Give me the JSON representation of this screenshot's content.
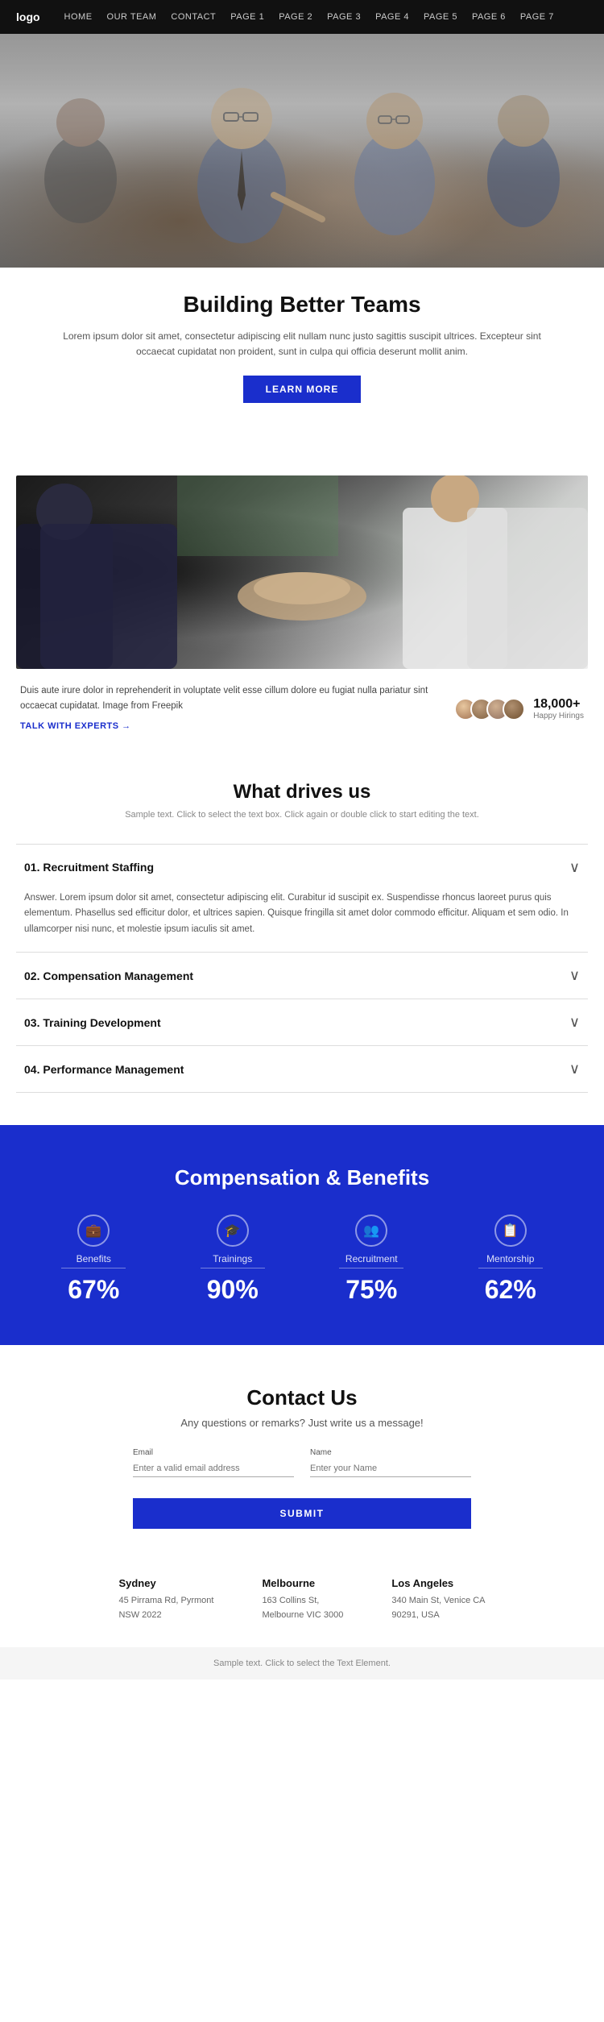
{
  "nav": {
    "logo": "logo",
    "links": [
      {
        "label": "HOME",
        "active": false
      },
      {
        "label": "OUR TEAM",
        "active": false
      },
      {
        "label": "CONTACT",
        "active": false
      },
      {
        "label": "PAGE 1",
        "active": false
      },
      {
        "label": "PAGE 2",
        "active": false
      },
      {
        "label": "PAGE 3",
        "active": false
      },
      {
        "label": "PAGE 4",
        "active": false
      },
      {
        "label": "PAGE 5",
        "active": false
      },
      {
        "label": "PAGE 6",
        "active": false
      },
      {
        "label": "PAGE 7",
        "active": false
      }
    ]
  },
  "hero": {
    "title": "Building Better Teams",
    "description": "Lorem ipsum dolor sit amet, consectetur adipiscing elit nullam nunc justo sagittis suscipit ultrices. Excepteur sint occaecat cupidatat non proident, sunt in culpa qui officia deserunt mollit anim.",
    "button_label": "LEARN MORE"
  },
  "stats": {
    "text": "Duis aute irure dolor in reprehenderit in voluptate velit esse cillum dolore eu fugiat nulla pariatur sint occaecat cupidatat. Image from Freepik",
    "link_label": "TALK WITH EXPERTS",
    "count": "18,000+",
    "count_label": "Happy Hirings"
  },
  "drives": {
    "title": "What drives us",
    "subtitle": "Sample text. Click to select the text box. Click again or double click to start editing the text.",
    "items": [
      {
        "number": "01.",
        "title": "Recruitment Staffing",
        "open": true,
        "answer": "Answer. Lorem ipsum dolor sit amet, consectetur adipiscing elit. Curabitur id suscipit ex. Suspendisse rhoncus laoreet purus quis elementum. Phasellus sed efficitur dolor, et ultrices sapien. Quisque fringilla sit amet dolor commodo efficitur. Aliquam et sem odio. In ullamcorper nisi nunc, et molestie ipsum iaculis sit amet."
      },
      {
        "number": "02.",
        "title": "Compensation Management",
        "open": false,
        "answer": ""
      },
      {
        "number": "03.",
        "title": "Training Development",
        "open": false,
        "answer": ""
      },
      {
        "number": "04.",
        "title": "Performance Management",
        "open": false,
        "answer": ""
      }
    ]
  },
  "comp": {
    "title": "Compensation & Benefits",
    "items": [
      {
        "label": "Benefits",
        "percent": "67%",
        "icon": "💼"
      },
      {
        "label": "Trainings",
        "percent": "90%",
        "icon": "🎓"
      },
      {
        "label": "Recruitment",
        "percent": "75%",
        "icon": "👥"
      },
      {
        "label": "Mentorship",
        "percent": "62%",
        "icon": "📋"
      }
    ]
  },
  "contact": {
    "title": "Contact Us",
    "subtitle": "Any questions or remarks? Just write us a message!",
    "email_label": "Email",
    "email_placeholder": "Enter a valid email address",
    "name_label": "Name",
    "name_placeholder": "Enter your Name",
    "button_label": "SUBMIT",
    "offices": [
      {
        "city": "Sydney",
        "address": "45 Pirrama Rd, Pyrmont",
        "postcode": "NSW 2022"
      },
      {
        "city": "Melbourne",
        "address": "163 Collins St,",
        "postcode": "Melbourne VIC 3000"
      },
      {
        "city": "Los Angeles",
        "address": "340 Main St, Venice CA",
        "postcode": "90291, USA"
      }
    ]
  },
  "footer": {
    "text": "Sample text. Click to select the Text Element."
  }
}
